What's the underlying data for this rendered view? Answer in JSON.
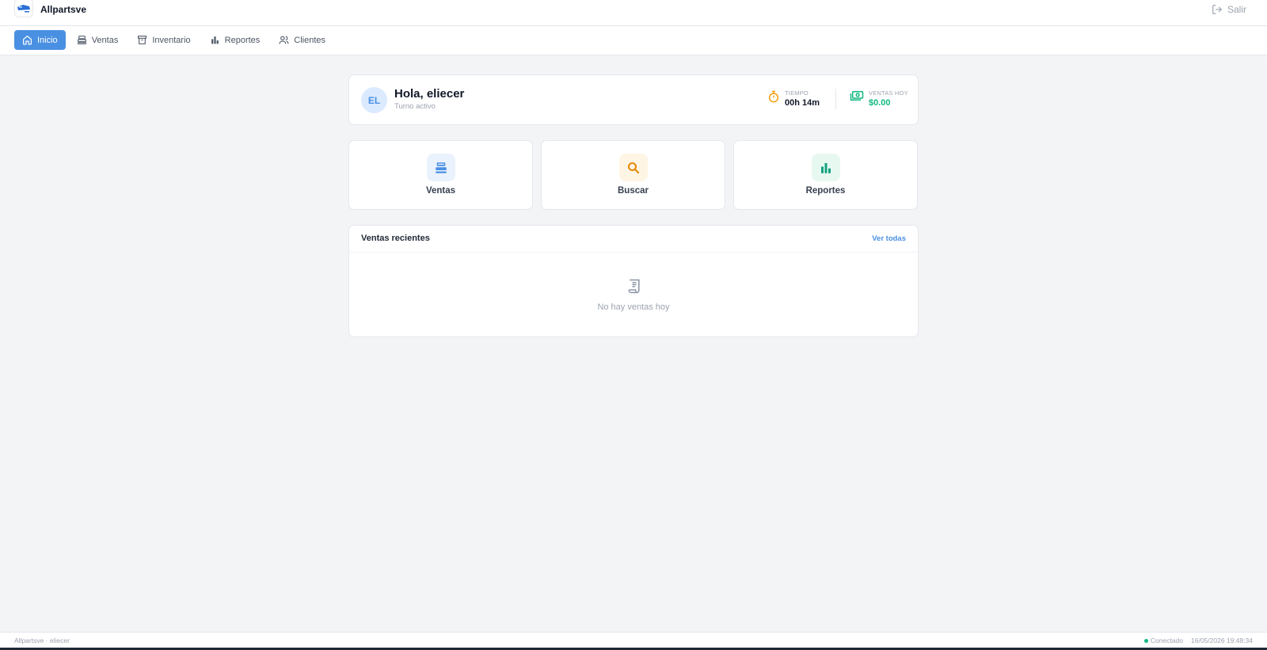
{
  "app": {
    "name": "Allpartsve",
    "logout_label": "Salir"
  },
  "nav": {
    "items": [
      {
        "label": "Inicio",
        "icon": "home-icon",
        "active": true
      },
      {
        "label": "Ventas",
        "icon": "register-icon"
      },
      {
        "label": "Inventario",
        "icon": "archive-icon"
      },
      {
        "label": "Reportes",
        "icon": "bar-chart-icon"
      },
      {
        "label": "Clientes",
        "icon": "users-icon"
      }
    ]
  },
  "welcome": {
    "avatar_initials": "EL",
    "greeting": "Hola, eliecer",
    "status": "Turno activo",
    "time_label": "TIEMPO",
    "time_value": "00h 14m",
    "sales_label": "VENTAS HOY",
    "sales_value": "$0.00"
  },
  "actions": [
    {
      "label": "Ventas",
      "icon": "register-icon",
      "color": "#4a90e2",
      "bg": "#eaf2fd"
    },
    {
      "label": "Buscar",
      "icon": "search-icon",
      "color": "#e6890a",
      "bg": "#fef5e4"
    },
    {
      "label": "Reportes",
      "icon": "bar-chart-icon",
      "color": "#10a37f",
      "bg": "#e7f8f1"
    }
  ],
  "recent": {
    "title": "Ventas recientes",
    "link": "Ver todas",
    "empty_text": "No hay ventas hoy"
  },
  "footer": {
    "left": "Allpartsve · eliecer",
    "status": "Conectado",
    "datetime": "16/05/2026 19:48:34"
  },
  "colors": {
    "primary": "#4a90e2",
    "success": "#10b981",
    "warning": "#f59e0b"
  }
}
